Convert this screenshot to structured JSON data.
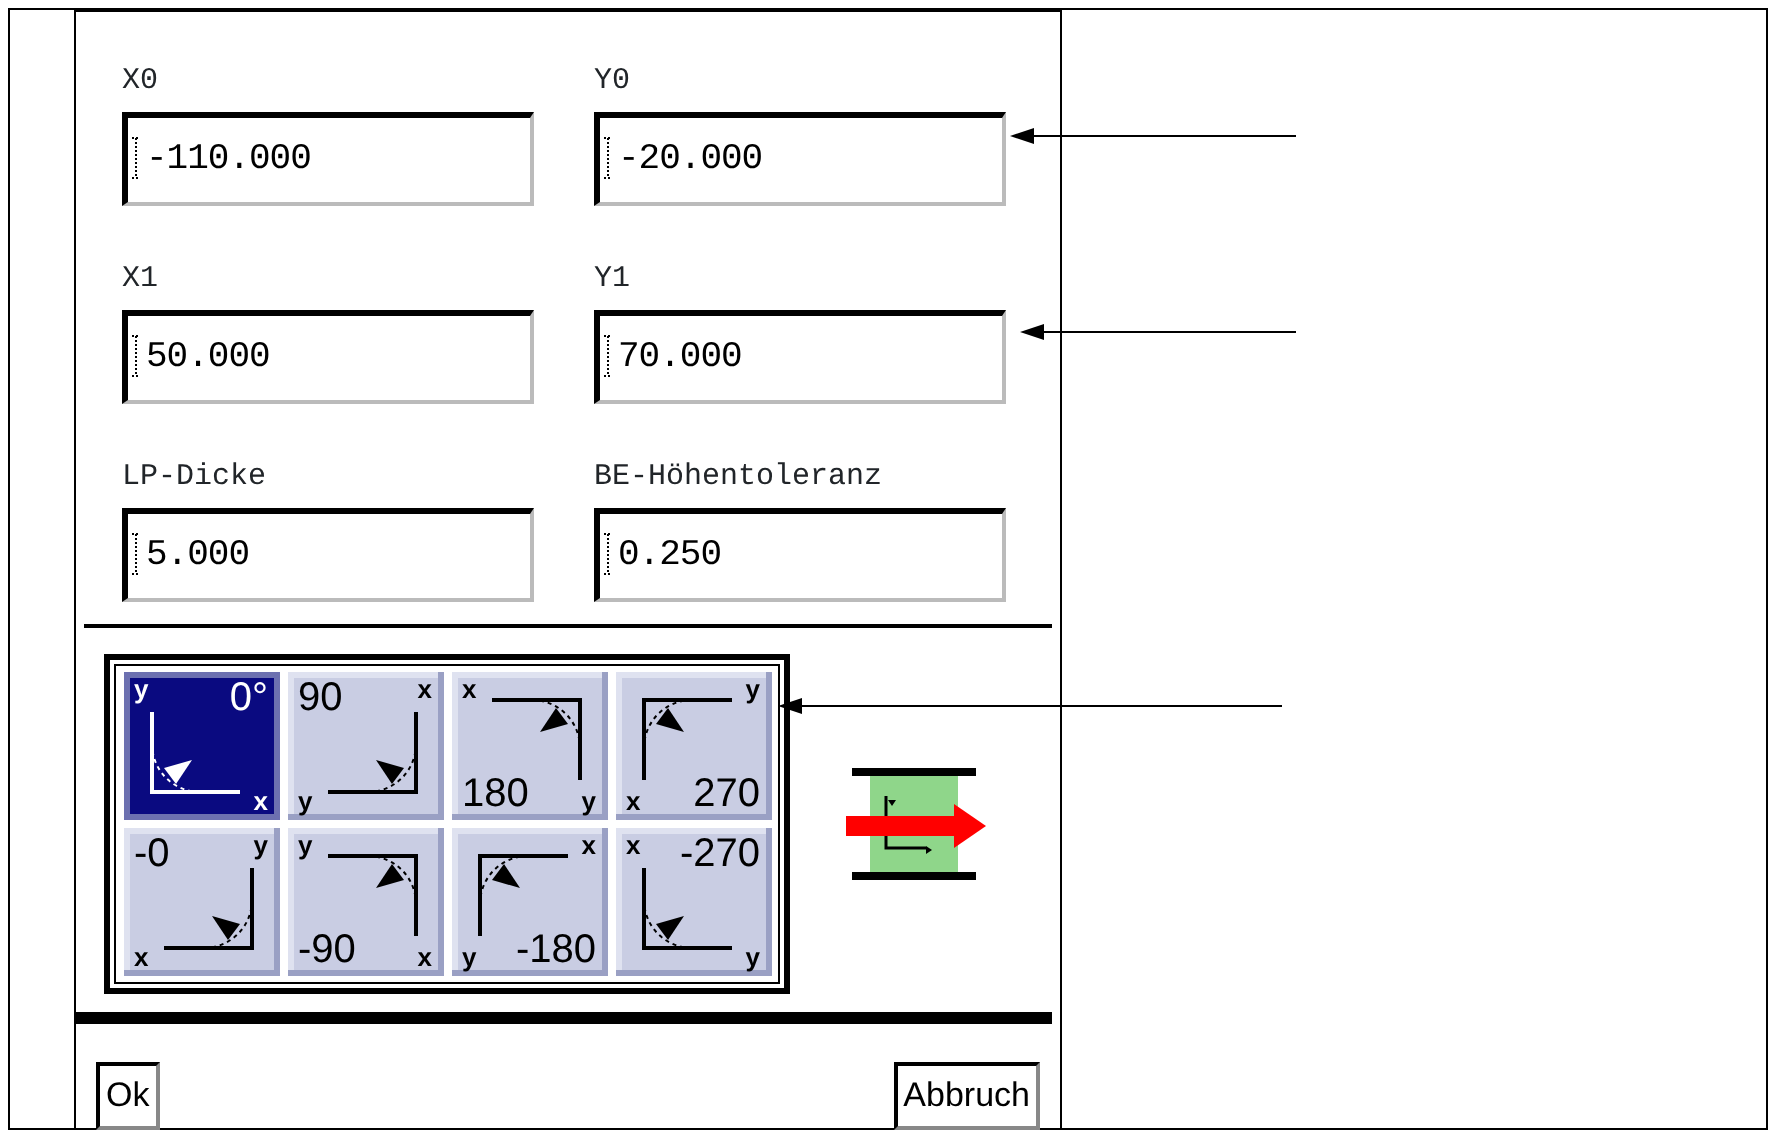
{
  "fields": [
    {
      "label": "X0",
      "value": "-110.000"
    },
    {
      "label": "Y0",
      "value": "-20.000"
    },
    {
      "label": "X1",
      "value": "50.000"
    },
    {
      "label": "Y1",
      "value": "70.000"
    },
    {
      "label": "LP-Dicke",
      "value": "5.000"
    },
    {
      "label": "BE-Höhentoleranz",
      "value": "0.250"
    }
  ],
  "orientations": [
    {
      "kind": "r0",
      "label": "0°",
      "selected": true,
      "x_axis": "x",
      "y_axis": "y"
    },
    {
      "kind": "r90",
      "label": "90",
      "selected": false,
      "x_axis": "x",
      "y_axis": "y"
    },
    {
      "kind": "r180",
      "label": "180",
      "selected": false,
      "x_axis": "x",
      "y_axis": "y"
    },
    {
      "kind": "r270",
      "label": "270",
      "selected": false,
      "x_axis": "x",
      "y_axis": "y"
    },
    {
      "kind": "m0",
      "label": "-0",
      "selected": false,
      "x_axis": "x",
      "y_axis": "y"
    },
    {
      "kind": "m90",
      "label": "-90",
      "selected": false,
      "x_axis": "x",
      "y_axis": "y"
    },
    {
      "kind": "m180",
      "label": "-180",
      "selected": false,
      "x_axis": "x",
      "y_axis": "y"
    },
    {
      "kind": "m270",
      "label": "-270",
      "selected": false,
      "x_axis": "x",
      "y_axis": "y"
    }
  ],
  "buttons": [
    "Ok",
    "Abbruch"
  ]
}
